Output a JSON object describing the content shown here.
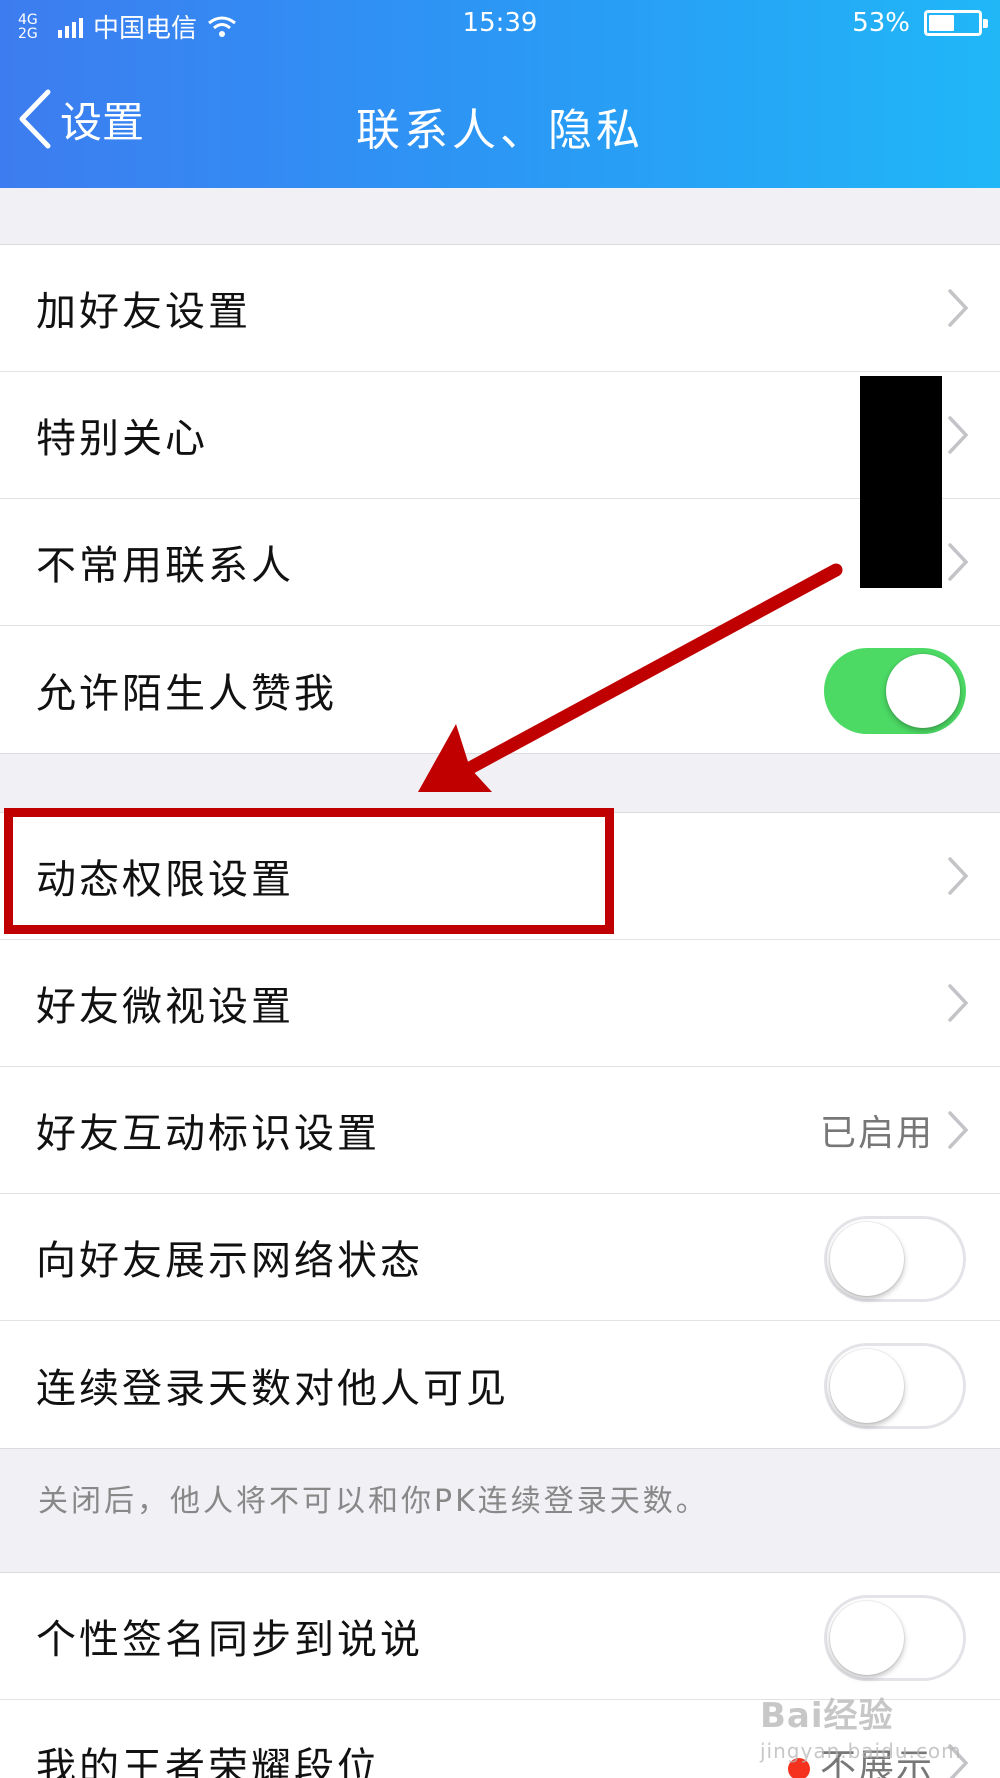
{
  "status_bar": {
    "network": "4G 2G",
    "carrier": "中国电信",
    "time": "15:39",
    "battery": "53%",
    "battery_level": 0.53
  },
  "nav": {
    "back_label": "设置",
    "title": "联系人、隐私"
  },
  "group1": [
    {
      "label": "加好友设置",
      "chevron": true
    },
    {
      "label": "特别关心",
      "chevron": true
    },
    {
      "label": "不常用联系人",
      "chevron": true
    },
    {
      "label": "允许陌生人赞我",
      "toggle": true,
      "on": true
    }
  ],
  "group2": [
    {
      "label": "动态权限设置",
      "chevron": true
    },
    {
      "label": "好友微视设置",
      "chevron": true
    },
    {
      "label": "好友互动标识设置",
      "value": "已启用",
      "chevron": true
    },
    {
      "label": "向好友展示网络状态",
      "toggle": true,
      "on": false
    },
    {
      "label": "连续登录天数对他人可见",
      "toggle": true,
      "on": false
    }
  ],
  "group2_footnote": "关闭后，他人将不可以和你PK连续登录天数。",
  "group3": [
    {
      "label": "个性签名同步到说说",
      "toggle": true,
      "on": false
    },
    {
      "label": "我的王者荣耀段位",
      "value": "不展示",
      "chevron": true,
      "dot": true
    }
  ],
  "colors": {
    "header_start": "#3d7cf0",
    "header_end": "#20b7f7",
    "toggle_on": "#4cd964",
    "annotation_red": "#c00000",
    "dot_red": "#f5321e"
  },
  "watermark": {
    "brand": "Bai经验",
    "url": "jingyan.baidu.com"
  }
}
